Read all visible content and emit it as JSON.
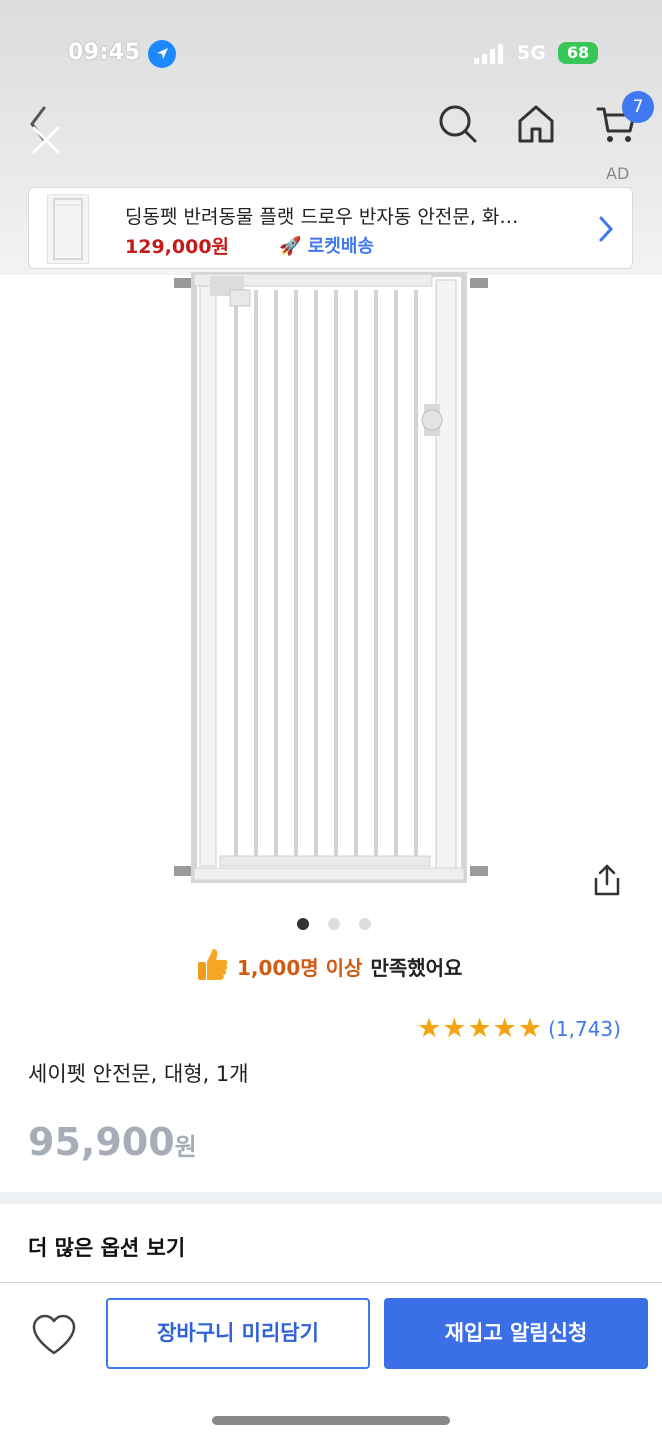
{
  "status_bar": {
    "time": "09:45",
    "network": "5G",
    "battery": "68"
  },
  "nav": {
    "cart_count": "7",
    "ad_label": "AD"
  },
  "ad": {
    "title": "딩동펫 반려동물 플랫 드로우 반자동 안전문, 화…",
    "price": "129,000원",
    "delivery": "로켓배송"
  },
  "gallery": {
    "current_index": 1,
    "total_images": 3
  },
  "satisfaction": {
    "highlight": "1,000명 이상",
    "text": "만족했어요"
  },
  "rating": {
    "stars": 5,
    "review_count": "(1,743)"
  },
  "product": {
    "name": "세이펫 안전문, 대형, 1개",
    "price_number": "95,900",
    "price_unit": "원"
  },
  "options": {
    "more_label": "더 많은 옵션 보기"
  },
  "actions": {
    "cart_label": "장바구니 미리담기",
    "restock_label": "재입고 알림신청"
  },
  "colors": {
    "accent": "#3f78f1",
    "ad_price": "#c51b1b",
    "star": "#f3a40e",
    "satisfaction_highlight": "#d05b12"
  }
}
